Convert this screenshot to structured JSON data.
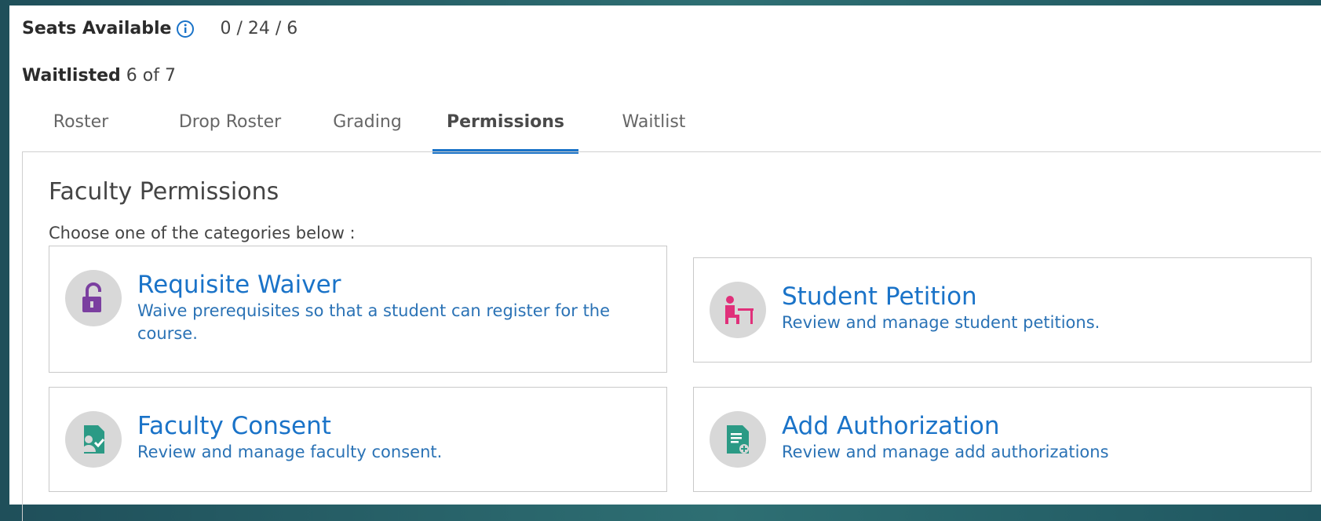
{
  "header": {
    "seats_label": "Seats Available",
    "seats_value": "0 / 24 / 6",
    "waitlisted_label": "Waitlisted",
    "waitlisted_value": "6 of 7"
  },
  "tabs": [
    {
      "label": "Roster",
      "active": false
    },
    {
      "label": "Drop Roster",
      "active": false
    },
    {
      "label": "Grading",
      "active": false
    },
    {
      "label": "Permissions",
      "active": true
    },
    {
      "label": "Waitlist",
      "active": false
    }
  ],
  "section": {
    "title": "Faculty Permissions",
    "subtitle": "Choose one of the categories below :"
  },
  "cards": [
    {
      "title": "Requisite Waiver",
      "description": "Waive prerequisites so that a student can register for the course.",
      "icon": "unlock-icon"
    },
    {
      "title": "Student Petition",
      "description": "Review and manage student petitions.",
      "icon": "student-desk-icon"
    },
    {
      "title": "Faculty Consent",
      "description": "Review and manage faculty consent.",
      "icon": "user-document-check-icon"
    },
    {
      "title": "Add Authorization",
      "description": "Review and manage add authorizations",
      "icon": "document-add-icon"
    }
  ],
  "colors": {
    "accent": "#1a73c8",
    "link_text": "#2a72b5",
    "icon_bg": "#d8d8d8",
    "waiver_icon": "#7b3fa0",
    "petition_icon": "#e0307a",
    "consent_icon": "#2b9a85",
    "authorization_icon": "#2b9a85"
  }
}
